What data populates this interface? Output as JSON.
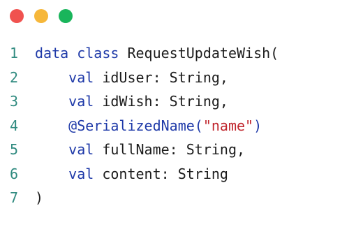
{
  "window": {
    "buttons": [
      {
        "name": "close-button",
        "color": "#f0524f"
      },
      {
        "name": "minimize-button",
        "color": "#f6b73a"
      },
      {
        "name": "zoom-button",
        "color": "#19b55b"
      }
    ]
  },
  "colors": {
    "line_number": "#2f8a7f",
    "keyword": "#1e39a8",
    "plain": "#1c1c1c",
    "string": "#c0262d"
  },
  "code": {
    "lines": [
      {
        "number": "1",
        "tokens": [
          {
            "type": "kw",
            "text": "data class"
          },
          {
            "type": "plain",
            "text": " RequestUpdateWish("
          }
        ]
      },
      {
        "number": "2",
        "tokens": [
          {
            "type": "plain",
            "text": "    "
          },
          {
            "type": "kw",
            "text": "val"
          },
          {
            "type": "plain",
            "text": " idUser: String,"
          }
        ]
      },
      {
        "number": "3",
        "tokens": [
          {
            "type": "plain",
            "text": "    "
          },
          {
            "type": "kw",
            "text": "val"
          },
          {
            "type": "plain",
            "text": " idWish: String,"
          }
        ]
      },
      {
        "number": "4",
        "tokens": [
          {
            "type": "plain",
            "text": "    "
          },
          {
            "type": "ann",
            "text": "@SerializedName("
          },
          {
            "type": "str",
            "text": "\"name\""
          },
          {
            "type": "ann",
            "text": ")"
          }
        ]
      },
      {
        "number": "5",
        "tokens": [
          {
            "type": "plain",
            "text": "    "
          },
          {
            "type": "kw",
            "text": "val"
          },
          {
            "type": "plain",
            "text": " fullName: String,"
          }
        ]
      },
      {
        "number": "6",
        "tokens": [
          {
            "type": "plain",
            "text": "    "
          },
          {
            "type": "kw",
            "text": "val"
          },
          {
            "type": "plain",
            "text": " content: String"
          }
        ]
      },
      {
        "number": "7",
        "tokens": [
          {
            "type": "plain",
            "text": ")"
          }
        ]
      }
    ]
  }
}
